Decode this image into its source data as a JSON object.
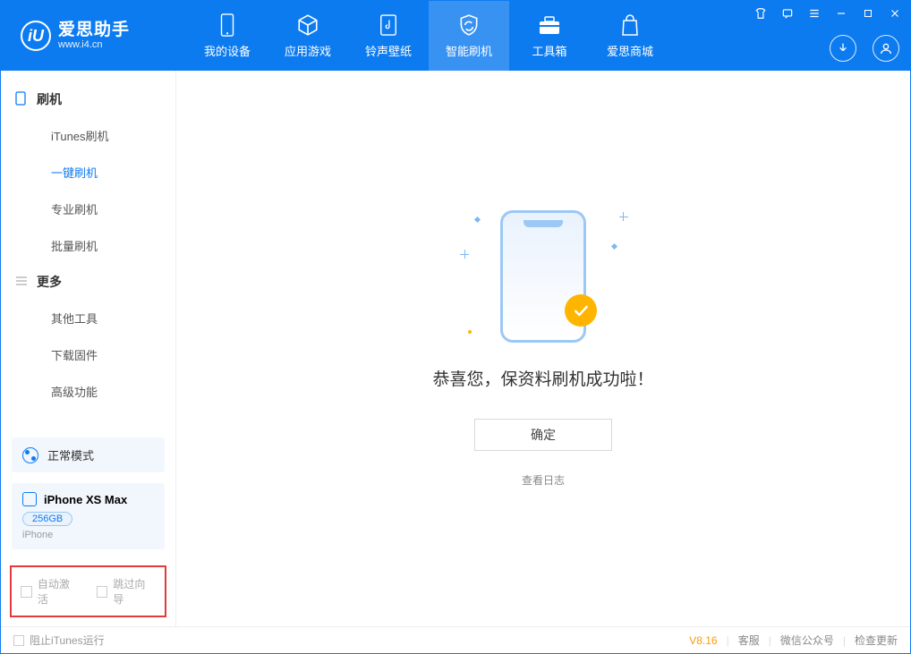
{
  "brand": {
    "name": "爱思助手",
    "site": "www.i4.cn",
    "logo_letter": "iU"
  },
  "nav": {
    "items": [
      {
        "label": "我的设备"
      },
      {
        "label": "应用游戏"
      },
      {
        "label": "铃声壁纸"
      },
      {
        "label": "智能刷机"
      },
      {
        "label": "工具箱"
      },
      {
        "label": "爱思商城"
      }
    ]
  },
  "sidebar": {
    "group1_title": "刷机",
    "group1": [
      {
        "label": "iTunes刷机"
      },
      {
        "label": "一键刷机"
      },
      {
        "label": "专业刷机"
      },
      {
        "label": "批量刷机"
      }
    ],
    "group2_title": "更多",
    "group2": [
      {
        "label": "其他工具"
      },
      {
        "label": "下载固件"
      },
      {
        "label": "高级功能"
      }
    ],
    "mode_label": "正常模式",
    "device_name": "iPhone XS Max",
    "device_capacity": "256GB",
    "device_type": "iPhone",
    "opt_auto_activate": "自动激活",
    "opt_skip_wizard": "跳过向导"
  },
  "main": {
    "success_text": "恭喜您，保资料刷机成功啦！",
    "ok_button": "确定",
    "view_log": "查看日志"
  },
  "status": {
    "block_itunes": "阻止iTunes运行",
    "version": "V8.16",
    "link_service": "客服",
    "link_wechat": "微信公众号",
    "link_update": "检查更新"
  }
}
